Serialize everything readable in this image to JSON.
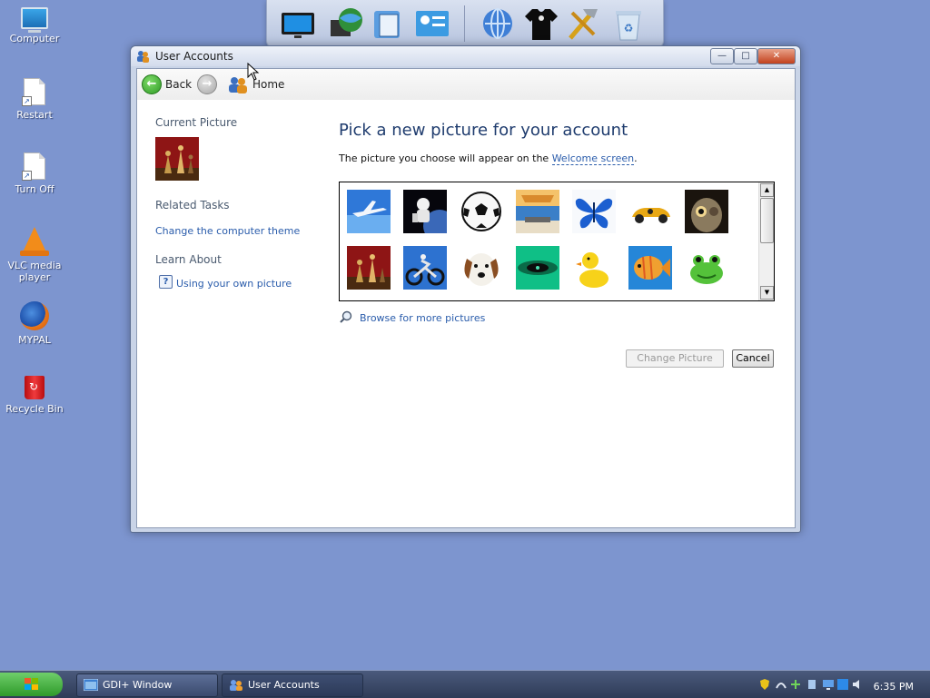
{
  "desktop": {
    "icons": [
      {
        "label": "Computer",
        "icon": "computer-icon"
      },
      {
        "label": "Restart",
        "icon": "restart-shortcut-icon"
      },
      {
        "label": "Turn Off",
        "icon": "turn-off-shortcut-icon"
      },
      {
        "label": "VLC media player",
        "icon": "vlc-icon"
      },
      {
        "label": "MYPAL",
        "icon": "mypal-browser-icon"
      },
      {
        "label": "Recycle Bin",
        "icon": "recycle-bin-icon"
      }
    ]
  },
  "dock": {
    "items": [
      "monitor-icon",
      "globe-folder-icon",
      "documents-icon",
      "control-panel-icon",
      "internet-icon",
      "tshirt-icon",
      "tools-icon",
      "recycle-bin-icon"
    ]
  },
  "window": {
    "title": "User Accounts",
    "controls": {
      "minimize": "—",
      "maximize": "□",
      "close": "✕"
    },
    "nav": {
      "back_label": "Back",
      "home_label": "Home"
    },
    "sidebar": {
      "current_picture_heading": "Current Picture",
      "related_tasks_heading": "Related Tasks",
      "related_tasks": [
        "Change the computer theme"
      ],
      "learn_about_heading": "Learn About",
      "learn_about": [
        "Using your own picture"
      ]
    },
    "main": {
      "title": "Pick a new picture for your account",
      "description_prefix": "The picture you choose will appear on the ",
      "description_link": "Welcome screen",
      "description_suffix": ".",
      "browse_label": "Browse for more pictures",
      "change_button": "Change Picture",
      "cancel_button": "Cancel",
      "pictures": [
        "airplane",
        "astronaut",
        "soccer ball",
        "beach chairs",
        "butterfly",
        "car",
        "owl",
        "chess",
        "dirt bike",
        "dog",
        "fish-eye",
        "duck",
        "fish",
        "frog"
      ]
    }
  },
  "taskbar": {
    "tasks": [
      {
        "label": "GDI+ Window",
        "active": false
      },
      {
        "label": "User Accounts",
        "active": true
      }
    ],
    "clock": "6:35 PM"
  },
  "colors": {
    "desktop": "#7d95cf",
    "link": "#2a5cab",
    "title_text": "#1f3c6e"
  }
}
